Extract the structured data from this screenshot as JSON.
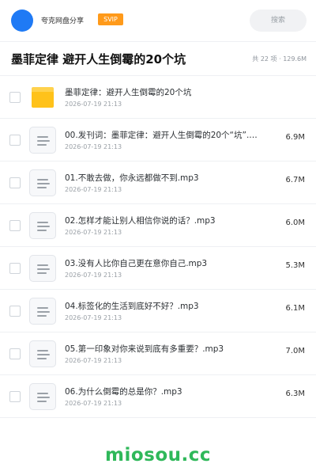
{
  "header": {
    "user_name": "夸克网盘分享",
    "badge": "SVIP",
    "search_label": "搜索"
  },
  "folder": {
    "title": "墨菲定律 避开人生倒霉的20个坑",
    "meta": "共 22 项 · 129.6M"
  },
  "files": [
    {
      "type": "folder",
      "name": "墨菲定律：避开人生倒霉的20个坑",
      "date": "2026-07-19 21:13",
      "size": ""
    },
    {
      "type": "file",
      "name": "00.发刊词：墨菲定律：避开人生倒霉的20个“坑”.mp3",
      "date": "2026-07-19 21:13",
      "size": "6.9M"
    },
    {
      "type": "file",
      "name": "01.不敢去做，你永远都做不到.mp3",
      "date": "2026-07-19 21:13",
      "size": "6.7M"
    },
    {
      "type": "file",
      "name": "02.怎样才能让别人相信你说的话？.mp3",
      "date": "2026-07-19 21:13",
      "size": "6.0M"
    },
    {
      "type": "file",
      "name": "03.没有人比你自己更在意你自己.mp3",
      "date": "2026-07-19 21:13",
      "size": "5.3M"
    },
    {
      "type": "file",
      "name": "04.标签化的生活到底好不好？.mp3",
      "date": "2026-07-19 21:13",
      "size": "6.1M"
    },
    {
      "type": "file",
      "name": "05.第一印象对你来说到底有多重要？.mp3",
      "date": "2026-07-19 21:13",
      "size": "7.0M"
    },
    {
      "type": "file",
      "name": "06.为什么倒霉的总是你？.mp3",
      "date": "2026-07-19 21:13",
      "size": "6.3M"
    }
  ],
  "watermark": "miosou.cc"
}
